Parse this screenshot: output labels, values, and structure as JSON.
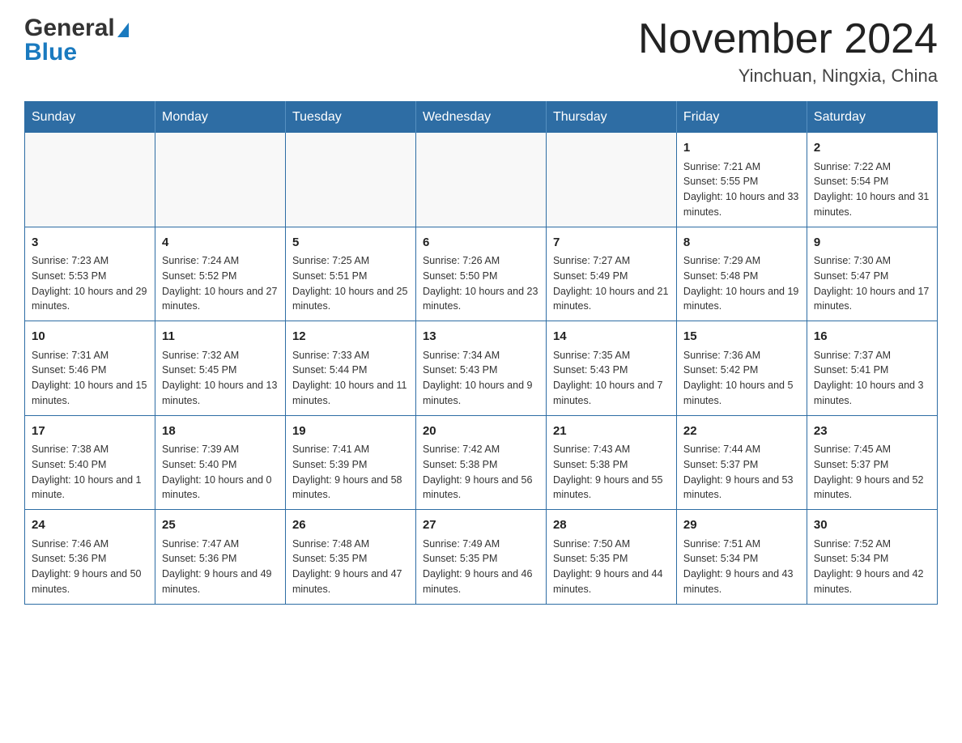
{
  "header": {
    "logo_general": "General",
    "logo_blue": "Blue",
    "month_title": "November 2024",
    "location": "Yinchuan, Ningxia, China"
  },
  "days_of_week": [
    "Sunday",
    "Monday",
    "Tuesday",
    "Wednesday",
    "Thursday",
    "Friday",
    "Saturday"
  ],
  "weeks": [
    [
      {
        "day": "",
        "info": ""
      },
      {
        "day": "",
        "info": ""
      },
      {
        "day": "",
        "info": ""
      },
      {
        "day": "",
        "info": ""
      },
      {
        "day": "",
        "info": ""
      },
      {
        "day": "1",
        "info": "Sunrise: 7:21 AM\nSunset: 5:55 PM\nDaylight: 10 hours and 33 minutes."
      },
      {
        "day": "2",
        "info": "Sunrise: 7:22 AM\nSunset: 5:54 PM\nDaylight: 10 hours and 31 minutes."
      }
    ],
    [
      {
        "day": "3",
        "info": "Sunrise: 7:23 AM\nSunset: 5:53 PM\nDaylight: 10 hours and 29 minutes."
      },
      {
        "day": "4",
        "info": "Sunrise: 7:24 AM\nSunset: 5:52 PM\nDaylight: 10 hours and 27 minutes."
      },
      {
        "day": "5",
        "info": "Sunrise: 7:25 AM\nSunset: 5:51 PM\nDaylight: 10 hours and 25 minutes."
      },
      {
        "day": "6",
        "info": "Sunrise: 7:26 AM\nSunset: 5:50 PM\nDaylight: 10 hours and 23 minutes."
      },
      {
        "day": "7",
        "info": "Sunrise: 7:27 AM\nSunset: 5:49 PM\nDaylight: 10 hours and 21 minutes."
      },
      {
        "day": "8",
        "info": "Sunrise: 7:29 AM\nSunset: 5:48 PM\nDaylight: 10 hours and 19 minutes."
      },
      {
        "day": "9",
        "info": "Sunrise: 7:30 AM\nSunset: 5:47 PM\nDaylight: 10 hours and 17 minutes."
      }
    ],
    [
      {
        "day": "10",
        "info": "Sunrise: 7:31 AM\nSunset: 5:46 PM\nDaylight: 10 hours and 15 minutes."
      },
      {
        "day": "11",
        "info": "Sunrise: 7:32 AM\nSunset: 5:45 PM\nDaylight: 10 hours and 13 minutes."
      },
      {
        "day": "12",
        "info": "Sunrise: 7:33 AM\nSunset: 5:44 PM\nDaylight: 10 hours and 11 minutes."
      },
      {
        "day": "13",
        "info": "Sunrise: 7:34 AM\nSunset: 5:43 PM\nDaylight: 10 hours and 9 minutes."
      },
      {
        "day": "14",
        "info": "Sunrise: 7:35 AM\nSunset: 5:43 PM\nDaylight: 10 hours and 7 minutes."
      },
      {
        "day": "15",
        "info": "Sunrise: 7:36 AM\nSunset: 5:42 PM\nDaylight: 10 hours and 5 minutes."
      },
      {
        "day": "16",
        "info": "Sunrise: 7:37 AM\nSunset: 5:41 PM\nDaylight: 10 hours and 3 minutes."
      }
    ],
    [
      {
        "day": "17",
        "info": "Sunrise: 7:38 AM\nSunset: 5:40 PM\nDaylight: 10 hours and 1 minute."
      },
      {
        "day": "18",
        "info": "Sunrise: 7:39 AM\nSunset: 5:40 PM\nDaylight: 10 hours and 0 minutes."
      },
      {
        "day": "19",
        "info": "Sunrise: 7:41 AM\nSunset: 5:39 PM\nDaylight: 9 hours and 58 minutes."
      },
      {
        "day": "20",
        "info": "Sunrise: 7:42 AM\nSunset: 5:38 PM\nDaylight: 9 hours and 56 minutes."
      },
      {
        "day": "21",
        "info": "Sunrise: 7:43 AM\nSunset: 5:38 PM\nDaylight: 9 hours and 55 minutes."
      },
      {
        "day": "22",
        "info": "Sunrise: 7:44 AM\nSunset: 5:37 PM\nDaylight: 9 hours and 53 minutes."
      },
      {
        "day": "23",
        "info": "Sunrise: 7:45 AM\nSunset: 5:37 PM\nDaylight: 9 hours and 52 minutes."
      }
    ],
    [
      {
        "day": "24",
        "info": "Sunrise: 7:46 AM\nSunset: 5:36 PM\nDaylight: 9 hours and 50 minutes."
      },
      {
        "day": "25",
        "info": "Sunrise: 7:47 AM\nSunset: 5:36 PM\nDaylight: 9 hours and 49 minutes."
      },
      {
        "day": "26",
        "info": "Sunrise: 7:48 AM\nSunset: 5:35 PM\nDaylight: 9 hours and 47 minutes."
      },
      {
        "day": "27",
        "info": "Sunrise: 7:49 AM\nSunset: 5:35 PM\nDaylight: 9 hours and 46 minutes."
      },
      {
        "day": "28",
        "info": "Sunrise: 7:50 AM\nSunset: 5:35 PM\nDaylight: 9 hours and 44 minutes."
      },
      {
        "day": "29",
        "info": "Sunrise: 7:51 AM\nSunset: 5:34 PM\nDaylight: 9 hours and 43 minutes."
      },
      {
        "day": "30",
        "info": "Sunrise: 7:52 AM\nSunset: 5:34 PM\nDaylight: 9 hours and 42 minutes."
      }
    ]
  ]
}
